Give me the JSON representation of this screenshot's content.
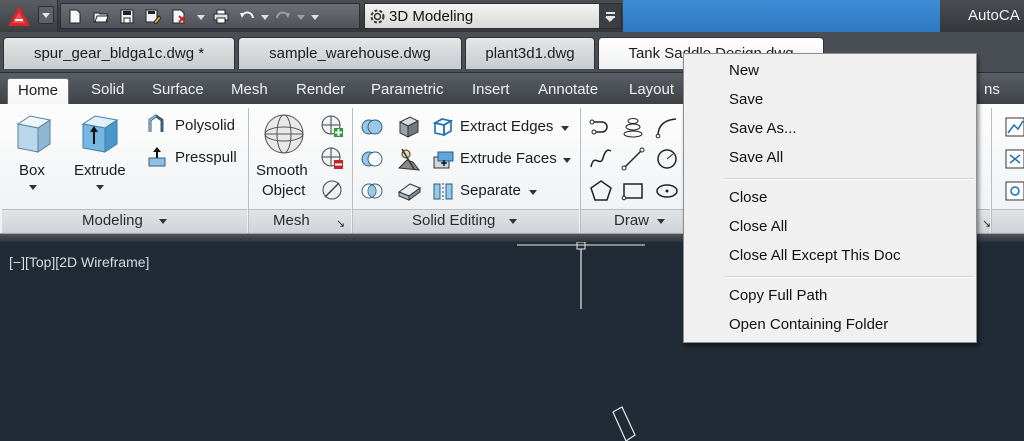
{
  "titlebar": {
    "workspace": "3D Modeling",
    "app_title": "AutoCA"
  },
  "file_tabs": [
    {
      "label": "spur_gear_bldga1c.dwg *"
    },
    {
      "label": "sample_warehouse.dwg"
    },
    {
      "label": "plant3d1.dwg"
    },
    {
      "label": "Tank Saddle Design.dwg"
    }
  ],
  "ribbon_tabs": [
    "Home",
    "Solid",
    "Surface",
    "Mesh",
    "Render",
    "Parametric",
    "Insert",
    "Annotate",
    "Layout",
    "ns"
  ],
  "panels": {
    "modeling": {
      "title": "Modeling",
      "box": "Box",
      "extrude": "Extrude",
      "polysolid": "Polysolid",
      "presspull": "Presspull"
    },
    "mesh": {
      "title": "Mesh",
      "smooth_line1": "Smooth",
      "smooth_line2": "Object"
    },
    "solid_editing": {
      "title": "Solid Editing",
      "extract_edges": "Extract Edges",
      "extrude_faces": "Extrude Faces",
      "separate": "Separate"
    },
    "draw": {
      "title": "Draw"
    }
  },
  "viewport": {
    "label": "[−][Top][2D Wireframe]"
  },
  "context_menu": {
    "groups": [
      [
        "New",
        "Save",
        "Save As...",
        "Save All"
      ],
      [
        "Close",
        "Close All",
        "Close All Except This Doc"
      ],
      [
        "Copy Full Path",
        "Open Containing Folder"
      ]
    ]
  },
  "colors": {
    "accent": "#2f79c2",
    "viewport_bg": "#202b35",
    "menu_bg": "#f0f0f0"
  }
}
